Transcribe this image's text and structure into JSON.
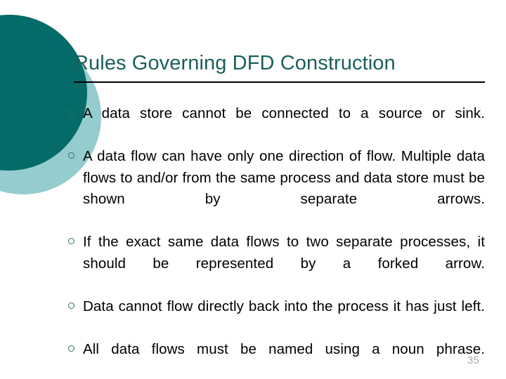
{
  "slide": {
    "title": "Rules Governing DFD Construction",
    "slide_number": "35",
    "colors": {
      "title_text": "#1a5f5d",
      "circle_dark": "#056b68",
      "circle_light": "#95cccd",
      "bullet_marker": "#2f6e6b",
      "body_text": "#000000",
      "rule": "#000000",
      "background": "#ffffff"
    },
    "bullets": [
      {
        "text": "A data store cannot be connected to a source or sink."
      },
      {
        "text": "A data flow can have only one direction of flow. Multiple data flows to and/or from the same process and data store must be shown by separate arrows."
      },
      {
        "text": "If the exact same data flows to two separate processes, it should be represented by a forked arrow."
      },
      {
        "text": "Data cannot flow directly back into the process it has just left."
      },
      {
        "text": "All data flows must be named using a noun phrase."
      }
    ]
  }
}
